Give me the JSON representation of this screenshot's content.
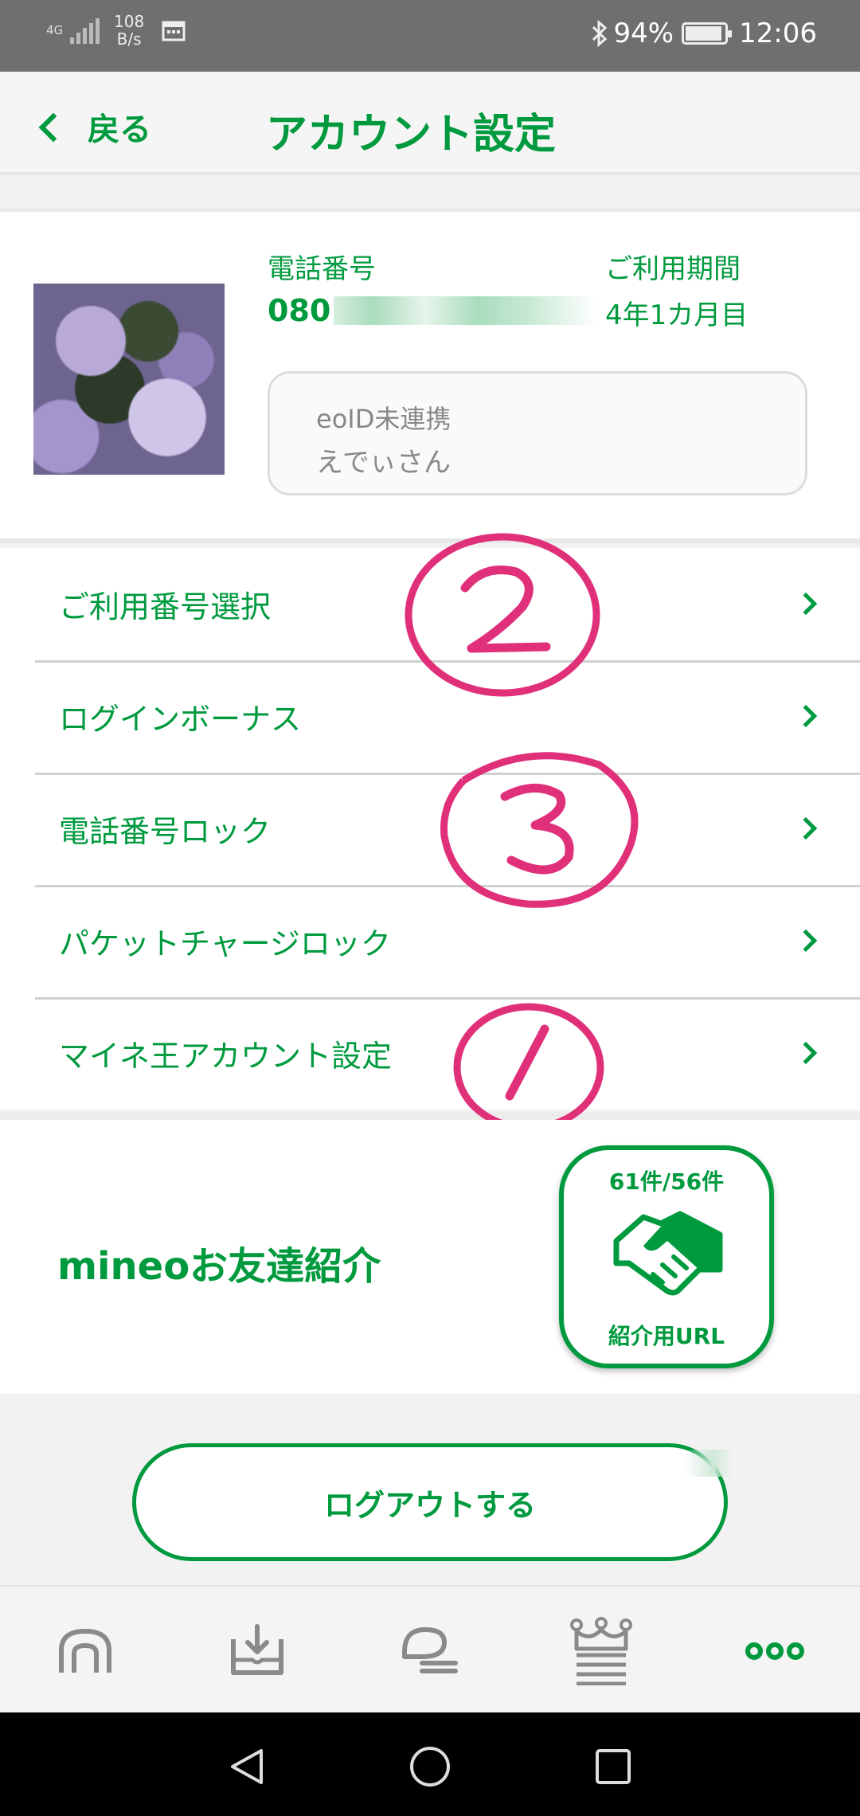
{
  "status_bar": {
    "network": "4G",
    "speed_value": "108",
    "speed_unit": "B/s",
    "battery": "94%",
    "battery_level": 0.94,
    "time": "12:06"
  },
  "header": {
    "back_label": "戻る",
    "title": "アカウント設定"
  },
  "profile": {
    "phone_label": "電話番号",
    "phone_value_visible": "080",
    "period_label": "ご利用期間",
    "period_value": "4年1カ月目",
    "eoid_status": "eoID未連携",
    "nickname": "えでぃさん"
  },
  "menu": {
    "items": [
      {
        "label": "ご利用番号選択"
      },
      {
        "label": "ログインボーナス"
      },
      {
        "label": "電話番号ロック"
      },
      {
        "label": "パケットチャージロック"
      },
      {
        "label": "マイネ王アカウント設定"
      }
    ]
  },
  "annotations": {
    "color": "#e0307a",
    "marks": [
      "2",
      "3",
      "1"
    ]
  },
  "referral": {
    "title": "mineoお友達紹介",
    "count": "61件/56件",
    "url_label": "紹介用URL"
  },
  "logout": {
    "label": "ログアウトする"
  },
  "tabbar": {
    "tabs": [
      "home-icon",
      "data-share-icon",
      "chat-icon",
      "king-icon",
      "more-icon"
    ],
    "active": "more-icon"
  },
  "colors": {
    "accent": "#009a3e",
    "inactive_icon": "#8a8a8a"
  }
}
